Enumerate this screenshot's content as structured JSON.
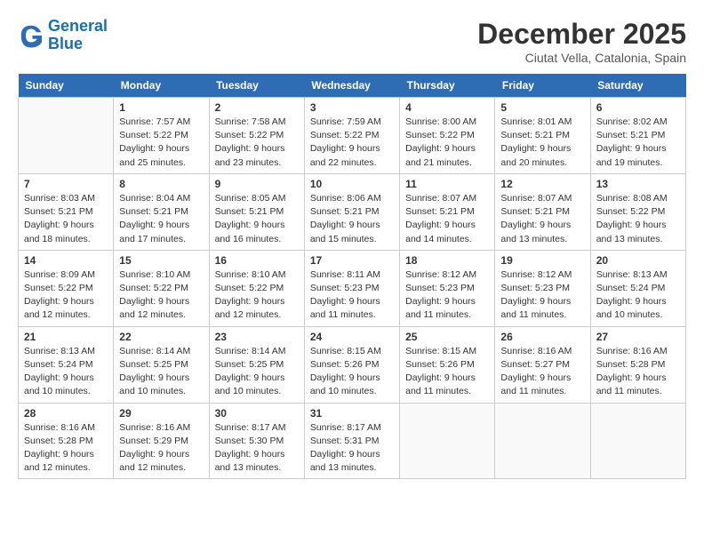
{
  "logo": {
    "line1": "General",
    "line2": "Blue"
  },
  "title": "December 2025",
  "location": "Ciutat Vella, Catalonia, Spain",
  "weekdays": [
    "Sunday",
    "Monday",
    "Tuesday",
    "Wednesday",
    "Thursday",
    "Friday",
    "Saturday"
  ],
  "weeks": [
    [
      {
        "day": "",
        "info": ""
      },
      {
        "day": "1",
        "info": "Sunrise: 7:57 AM\nSunset: 5:22 PM\nDaylight: 9 hours\nand 25 minutes."
      },
      {
        "day": "2",
        "info": "Sunrise: 7:58 AM\nSunset: 5:22 PM\nDaylight: 9 hours\nand 23 minutes."
      },
      {
        "day": "3",
        "info": "Sunrise: 7:59 AM\nSunset: 5:22 PM\nDaylight: 9 hours\nand 22 minutes."
      },
      {
        "day": "4",
        "info": "Sunrise: 8:00 AM\nSunset: 5:22 PM\nDaylight: 9 hours\nand 21 minutes."
      },
      {
        "day": "5",
        "info": "Sunrise: 8:01 AM\nSunset: 5:21 PM\nDaylight: 9 hours\nand 20 minutes."
      },
      {
        "day": "6",
        "info": "Sunrise: 8:02 AM\nSunset: 5:21 PM\nDaylight: 9 hours\nand 19 minutes."
      }
    ],
    [
      {
        "day": "7",
        "info": "Sunrise: 8:03 AM\nSunset: 5:21 PM\nDaylight: 9 hours\nand 18 minutes."
      },
      {
        "day": "8",
        "info": "Sunrise: 8:04 AM\nSunset: 5:21 PM\nDaylight: 9 hours\nand 17 minutes."
      },
      {
        "day": "9",
        "info": "Sunrise: 8:05 AM\nSunset: 5:21 PM\nDaylight: 9 hours\nand 16 minutes."
      },
      {
        "day": "10",
        "info": "Sunrise: 8:06 AM\nSunset: 5:21 PM\nDaylight: 9 hours\nand 15 minutes."
      },
      {
        "day": "11",
        "info": "Sunrise: 8:07 AM\nSunset: 5:21 PM\nDaylight: 9 hours\nand 14 minutes."
      },
      {
        "day": "12",
        "info": "Sunrise: 8:07 AM\nSunset: 5:21 PM\nDaylight: 9 hours\nand 13 minutes."
      },
      {
        "day": "13",
        "info": "Sunrise: 8:08 AM\nSunset: 5:22 PM\nDaylight: 9 hours\nand 13 minutes."
      }
    ],
    [
      {
        "day": "14",
        "info": "Sunrise: 8:09 AM\nSunset: 5:22 PM\nDaylight: 9 hours\nand 12 minutes."
      },
      {
        "day": "15",
        "info": "Sunrise: 8:10 AM\nSunset: 5:22 PM\nDaylight: 9 hours\nand 12 minutes."
      },
      {
        "day": "16",
        "info": "Sunrise: 8:10 AM\nSunset: 5:22 PM\nDaylight: 9 hours\nand 12 minutes."
      },
      {
        "day": "17",
        "info": "Sunrise: 8:11 AM\nSunset: 5:23 PM\nDaylight: 9 hours\nand 11 minutes."
      },
      {
        "day": "18",
        "info": "Sunrise: 8:12 AM\nSunset: 5:23 PM\nDaylight: 9 hours\nand 11 minutes."
      },
      {
        "day": "19",
        "info": "Sunrise: 8:12 AM\nSunset: 5:23 PM\nDaylight: 9 hours\nand 11 minutes."
      },
      {
        "day": "20",
        "info": "Sunrise: 8:13 AM\nSunset: 5:24 PM\nDaylight: 9 hours\nand 10 minutes."
      }
    ],
    [
      {
        "day": "21",
        "info": "Sunrise: 8:13 AM\nSunset: 5:24 PM\nDaylight: 9 hours\nand 10 minutes."
      },
      {
        "day": "22",
        "info": "Sunrise: 8:14 AM\nSunset: 5:25 PM\nDaylight: 9 hours\nand 10 minutes."
      },
      {
        "day": "23",
        "info": "Sunrise: 8:14 AM\nSunset: 5:25 PM\nDaylight: 9 hours\nand 10 minutes."
      },
      {
        "day": "24",
        "info": "Sunrise: 8:15 AM\nSunset: 5:26 PM\nDaylight: 9 hours\nand 10 minutes."
      },
      {
        "day": "25",
        "info": "Sunrise: 8:15 AM\nSunset: 5:26 PM\nDaylight: 9 hours\nand 11 minutes."
      },
      {
        "day": "26",
        "info": "Sunrise: 8:16 AM\nSunset: 5:27 PM\nDaylight: 9 hours\nand 11 minutes."
      },
      {
        "day": "27",
        "info": "Sunrise: 8:16 AM\nSunset: 5:28 PM\nDaylight: 9 hours\nand 11 minutes."
      }
    ],
    [
      {
        "day": "28",
        "info": "Sunrise: 8:16 AM\nSunset: 5:28 PM\nDaylight: 9 hours\nand 12 minutes."
      },
      {
        "day": "29",
        "info": "Sunrise: 8:16 AM\nSunset: 5:29 PM\nDaylight: 9 hours\nand 12 minutes."
      },
      {
        "day": "30",
        "info": "Sunrise: 8:17 AM\nSunset: 5:30 PM\nDaylight: 9 hours\nand 13 minutes."
      },
      {
        "day": "31",
        "info": "Sunrise: 8:17 AM\nSunset: 5:31 PM\nDaylight: 9 hours\nand 13 minutes."
      },
      {
        "day": "",
        "info": ""
      },
      {
        "day": "",
        "info": ""
      },
      {
        "day": "",
        "info": ""
      }
    ]
  ]
}
